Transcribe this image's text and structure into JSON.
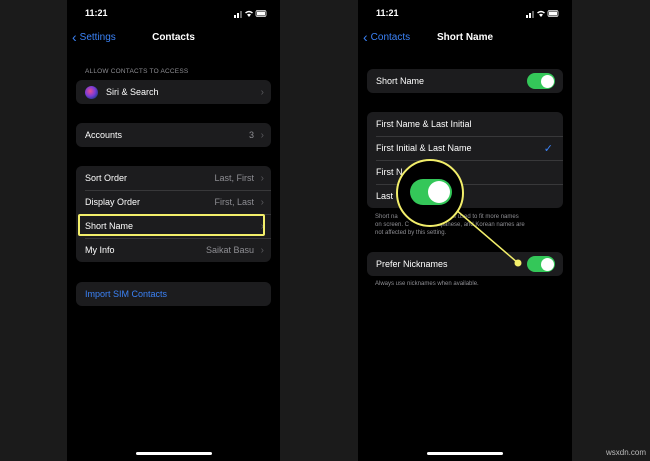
{
  "left": {
    "status_time": "11:21",
    "back_label": "Settings",
    "title": "Contacts",
    "section_header": "ALLOW CONTACTS TO ACCESS",
    "siri_label": "Siri & Search",
    "accounts": {
      "label": "Accounts",
      "value": "3"
    },
    "sort_order": {
      "label": "Sort Order",
      "value": "Last, First"
    },
    "display_order": {
      "label": "Display Order",
      "value": "First, Last"
    },
    "short_name": {
      "label": "Short Name"
    },
    "my_info": {
      "label": "My Info",
      "value": "Saikat Basu"
    },
    "import_sim": "Import SIM Contacts"
  },
  "right": {
    "status_time": "11:21",
    "back_label": "Contacts",
    "title": "Short Name",
    "short_name_toggle": {
      "label": "Short Name",
      "on": true
    },
    "options": [
      {
        "label": "First Name & Last Initial",
        "selected": false
      },
      {
        "label": "First Initial & Last Name",
        "selected": true
      },
      {
        "label": "First N",
        "selected": false
      },
      {
        "label": "Last",
        "selected": false
      }
    ],
    "footnote_line1": "Short na",
    "footnote_line1b": "es used to fit more names",
    "footnote_line2": "on screen. C",
    "footnote_line2b": ", Japanese, and Korean names are",
    "footnote_line3": "not affected by this setting.",
    "prefer_nicknames": {
      "label": "Prefer Nicknames",
      "on": true
    },
    "prefer_footnote": "Always use nicknames when available."
  },
  "watermark": "wsxdn.com",
  "colors": {
    "accent": "#3b82f6",
    "toggle_on": "#34c759",
    "highlight": "#f2ee6a"
  }
}
